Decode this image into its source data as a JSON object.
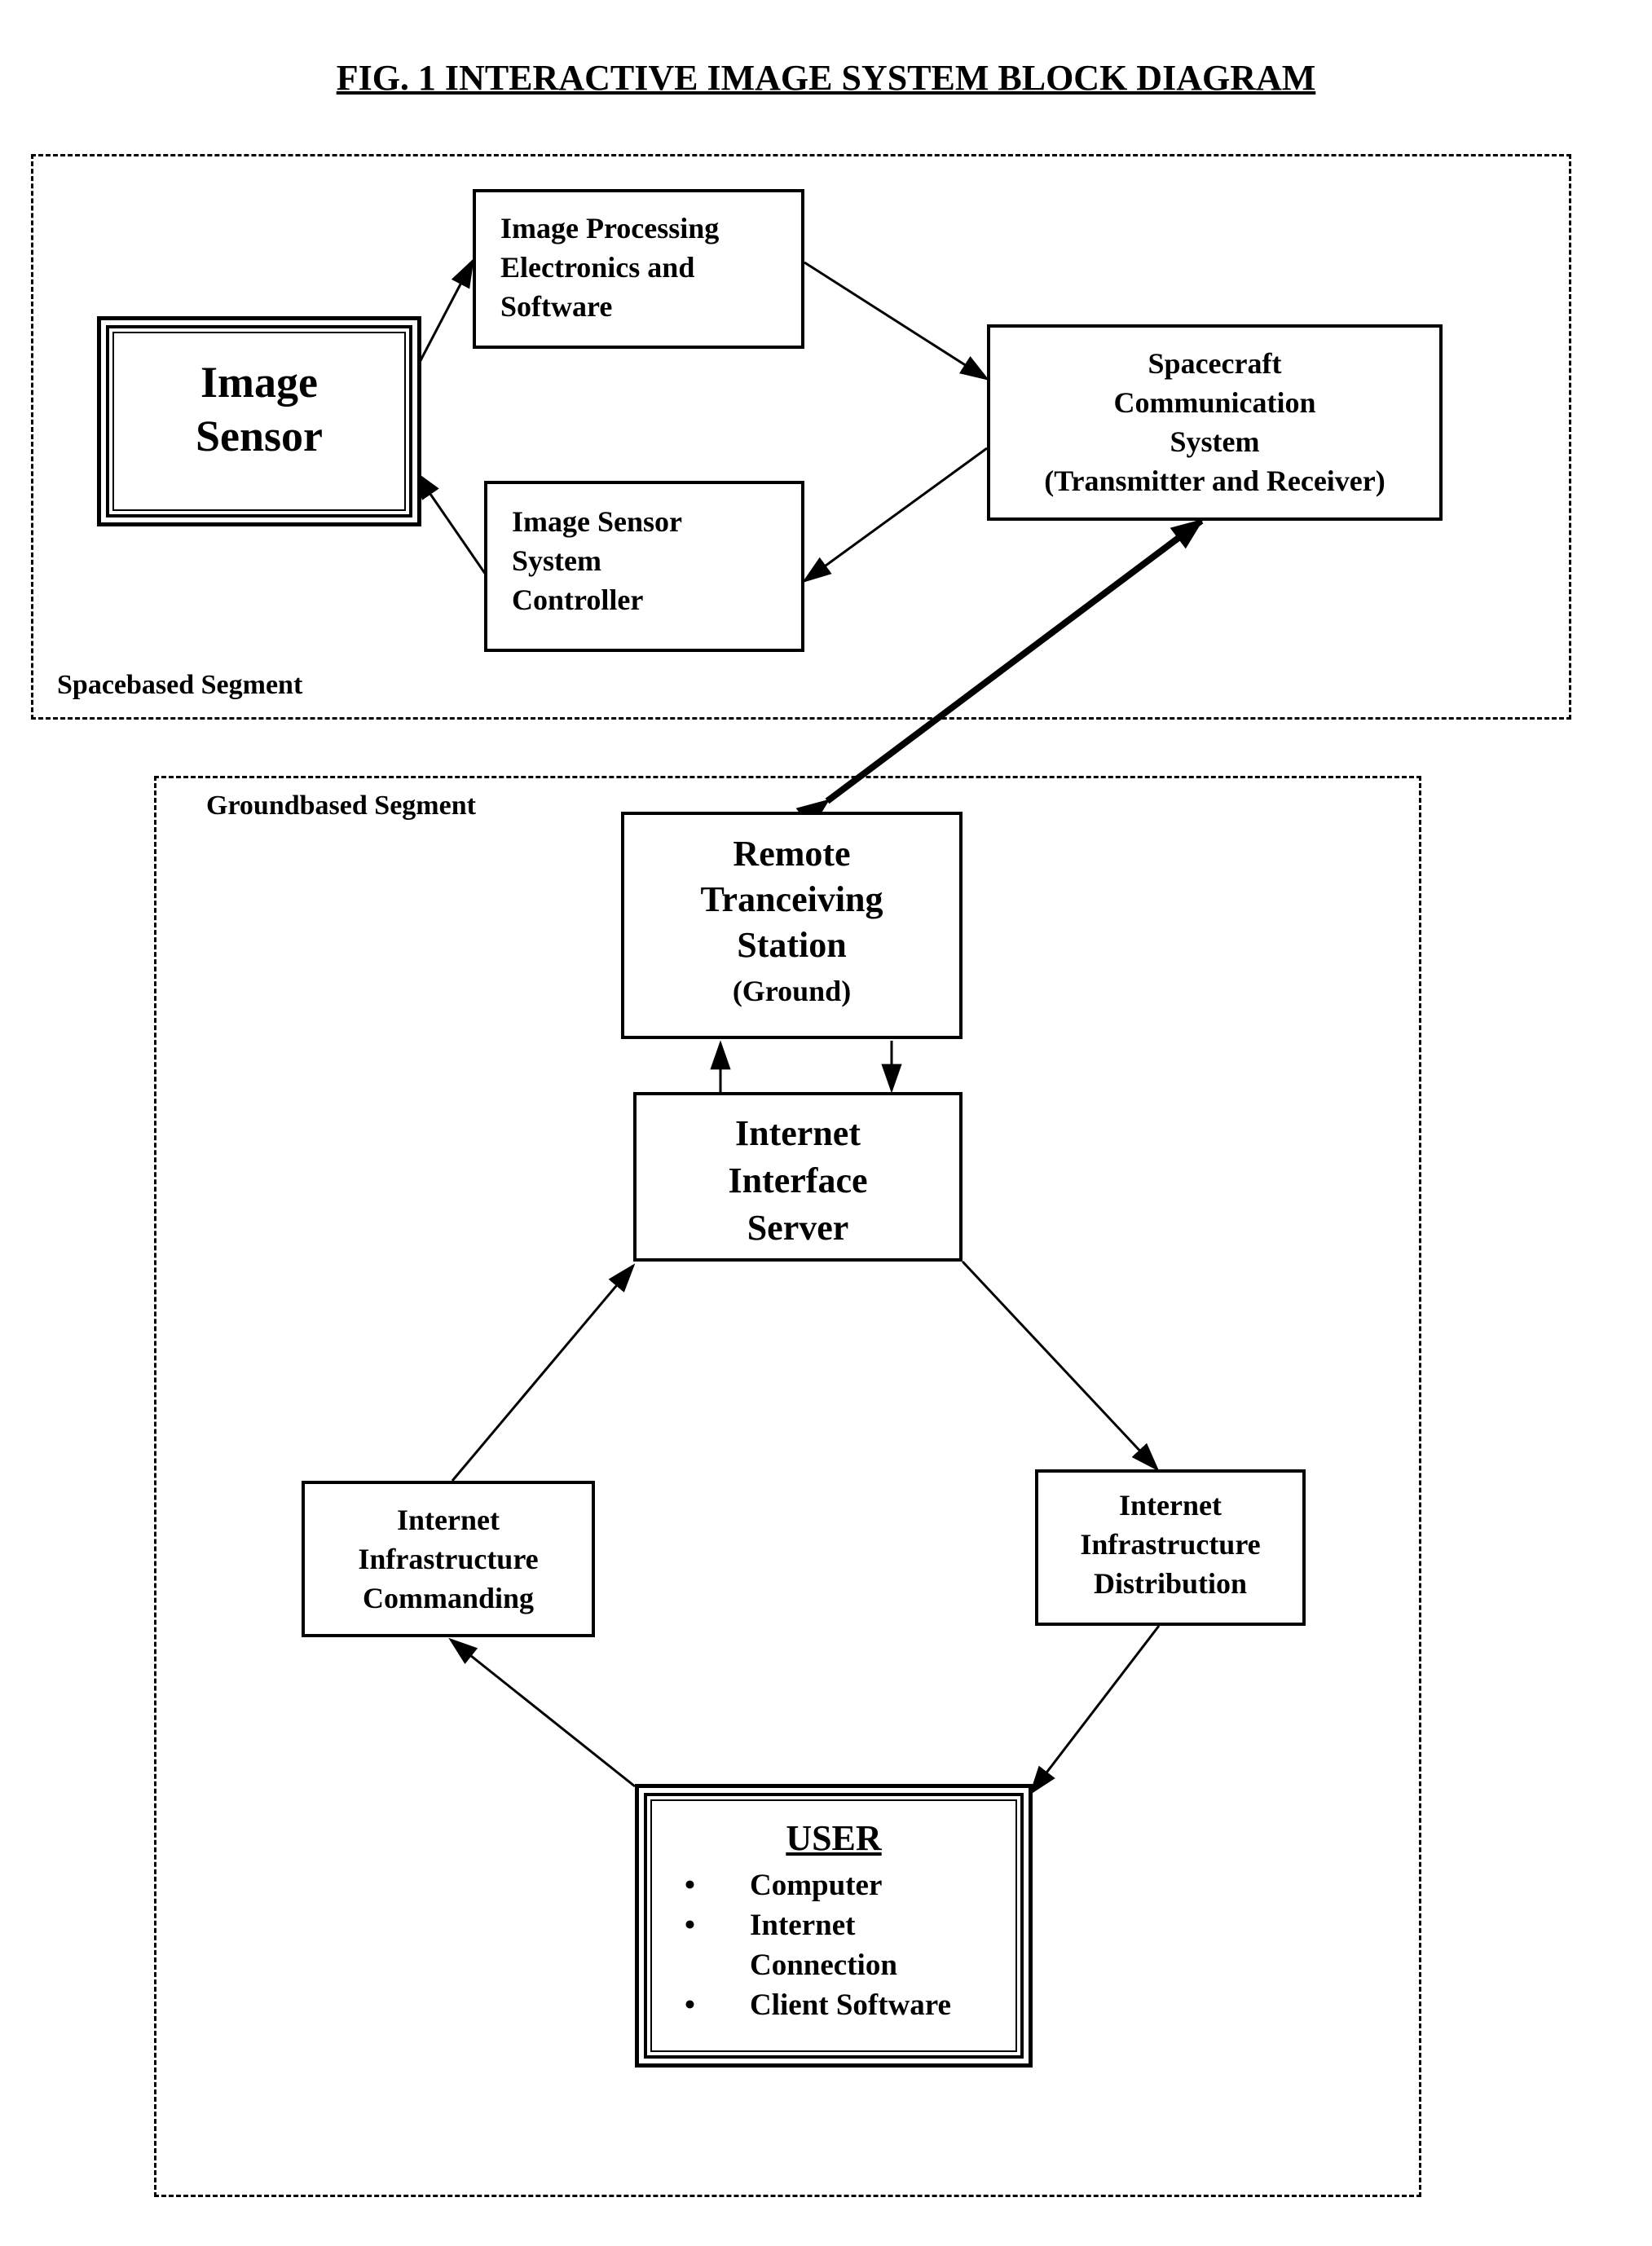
{
  "title": "FIG. 1 INTERACTIVE IMAGE SYSTEM BLOCK DIAGRAM",
  "segments": {
    "space": {
      "label": "Spacebased Segment"
    },
    "ground": {
      "label": "Groundbased Segment"
    }
  },
  "blocks": {
    "image_sensor": {
      "lines": [
        "Image",
        "Sensor"
      ]
    },
    "image_processing": {
      "lines": [
        "Image Processing",
        "Electronics and",
        "Software"
      ]
    },
    "sensor_controller": {
      "lines": [
        "Image Sensor",
        "System",
        "Controller"
      ]
    },
    "spacecraft_comm": {
      "lines": [
        "Spacecraft",
        "Communication",
        "System",
        "(Transmitter and Receiver)"
      ]
    },
    "remote_station": {
      "lines": [
        "Remote",
        "Tranceiving",
        "Station",
        "(Ground)"
      ]
    },
    "interface_server": {
      "lines": [
        "Internet",
        "Interface",
        "Server"
      ]
    },
    "commanding": {
      "lines": [
        "Internet",
        "Infrastructure",
        "Commanding"
      ]
    },
    "distribution": {
      "lines": [
        "Internet",
        "Infrastructure",
        "Distribution"
      ]
    },
    "user": {
      "heading": "USER",
      "bullet": "•",
      "items": [
        "Computer",
        "Internet",
        "Connection",
        "Client Software"
      ]
    }
  }
}
